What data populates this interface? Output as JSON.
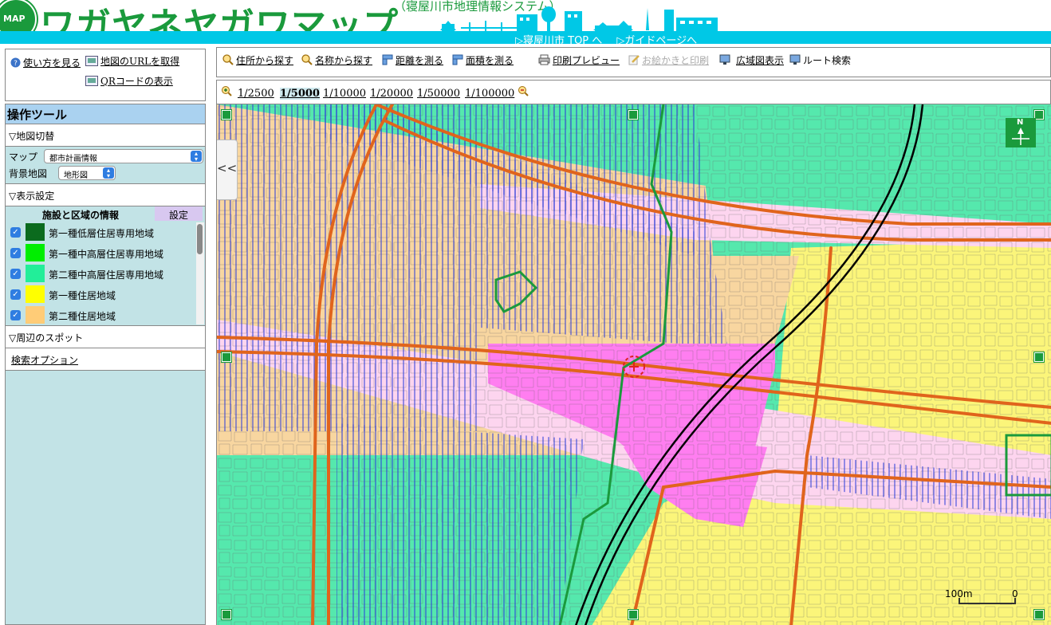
{
  "header": {
    "logo_text": "MAP",
    "title": "ワガヤネヤガワマップ",
    "subtitle": "（寝屋川市地理情報システム）",
    "links": [
      "▷寝屋川市 TOP へ",
      "▷ガイドページへ"
    ]
  },
  "help": {
    "how_to": "使い方を見る",
    "map_url": "地図のURLを取得",
    "qr": "QRコードの表示"
  },
  "tools_panel": {
    "title": "操作ツール",
    "map_switch": "▽地図切替",
    "map_label": "マップ",
    "map_value": "都市計画情報",
    "bg_label": "背景地図",
    "bg_value": "地形図",
    "display_settings": "▽表示設定",
    "legend_header": "施設と区域の情報",
    "legend_setting": "設定",
    "legend_items": [
      {
        "label": "第一種低層住居専用地域",
        "color": "#0b6b1e",
        "checked": true
      },
      {
        "label": "第一種中高層住居専用地域",
        "color": "#00ee00",
        "checked": true
      },
      {
        "label": "第二種中高層住居専用地域",
        "color": "#22ee99",
        "checked": true
      },
      {
        "label": "第一種住居地域",
        "color": "#ffff00",
        "checked": true
      },
      {
        "label": "第二種住居地域",
        "color": "#ffcc77",
        "checked": true
      }
    ],
    "nearby_spots": "▽周辺のスポット",
    "search_option": "検索オプション"
  },
  "toolbar": {
    "address_search": "住所から探す",
    "name_search": "名称から探す",
    "measure_distance": "距離を測る",
    "measure_area": "面積を測る",
    "print_preview": "印刷プレビュー",
    "draw_print": "お絵かきと印刷",
    "wide_view": "広域図表示",
    "route_search": "ルート検索"
  },
  "scales": {
    "items": [
      "1/2500",
      "1/5000",
      "1/10000",
      "1/20000",
      "1/50000",
      "1/100000"
    ],
    "active": "1/5000"
  },
  "map": {
    "collapse": "<<",
    "north": "N",
    "scale_left": "100m",
    "scale_right": "0",
    "colors": {
      "residential2_midhigh": "#55e8ad",
      "residential1": "#fbf57a",
      "residential2": "#f8d6a0",
      "commercial": "#ff7ef0",
      "neighborhood_commercial": "#fdd5ef",
      "road_orange": "#e0641c",
      "hatch_blue": "#2c3cd8",
      "rail": "#000000"
    }
  }
}
